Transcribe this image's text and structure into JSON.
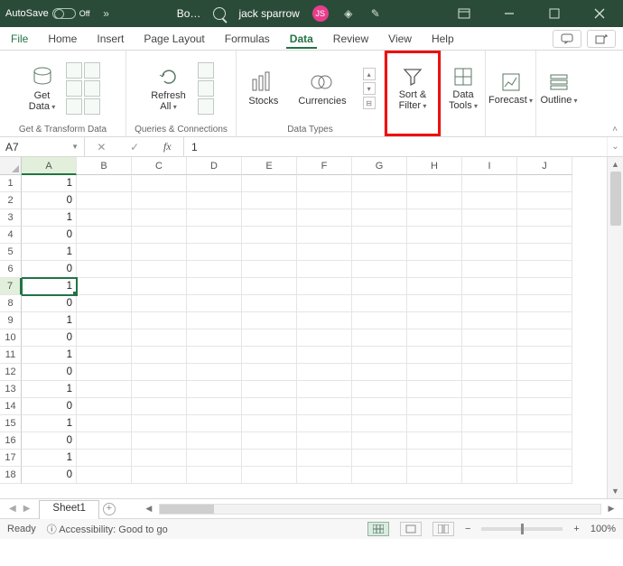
{
  "titlebar": {
    "autosave_label": "AutoSave",
    "autosave_state": "Off",
    "overflow": "»",
    "book_name": "Bo…",
    "user_name": "jack sparrow",
    "user_initials": "JS"
  },
  "menu": {
    "tabs": [
      "File",
      "Home",
      "Insert",
      "Page Layout",
      "Formulas",
      "Data",
      "Review",
      "View",
      "Help"
    ],
    "active": "Data"
  },
  "ribbon": {
    "get_transform_label": "Get & Transform Data",
    "get_data": "Get\nData",
    "queries_conn_label": "Queries & Connections",
    "refresh_all": "Refresh\nAll",
    "data_types_label": "Data Types",
    "stocks": "Stocks",
    "currencies": "Currencies",
    "sort_filter": "Sort &\nFilter",
    "data_tools": "Data\nTools",
    "forecast": "Forecast",
    "outline": "Outline"
  },
  "formula": {
    "namebox": "A7",
    "value": "1"
  },
  "grid": {
    "columns": [
      "A",
      "B",
      "C",
      "D",
      "E",
      "F",
      "G",
      "H",
      "I",
      "J"
    ],
    "rows": [
      {
        "n": 1,
        "A": "1"
      },
      {
        "n": 2,
        "A": "0"
      },
      {
        "n": 3,
        "A": "1"
      },
      {
        "n": 4,
        "A": "0"
      },
      {
        "n": 5,
        "A": "1"
      },
      {
        "n": 6,
        "A": "0"
      },
      {
        "n": 7,
        "A": "1"
      },
      {
        "n": 8,
        "A": "0"
      },
      {
        "n": 9,
        "A": "1"
      },
      {
        "n": 10,
        "A": "0"
      },
      {
        "n": 11,
        "A": "1"
      },
      {
        "n": 12,
        "A": "0"
      },
      {
        "n": 13,
        "A": "1"
      },
      {
        "n": 14,
        "A": "0"
      },
      {
        "n": 15,
        "A": "1"
      },
      {
        "n": 16,
        "A": "0"
      },
      {
        "n": 17,
        "A": "1"
      },
      {
        "n": 18,
        "A": "0"
      }
    ],
    "selected_cell": "A7"
  },
  "sheets": {
    "active": "Sheet1"
  },
  "status": {
    "ready": "Ready",
    "accessibility": "Accessibility: Good to go",
    "zoom": "100%"
  }
}
